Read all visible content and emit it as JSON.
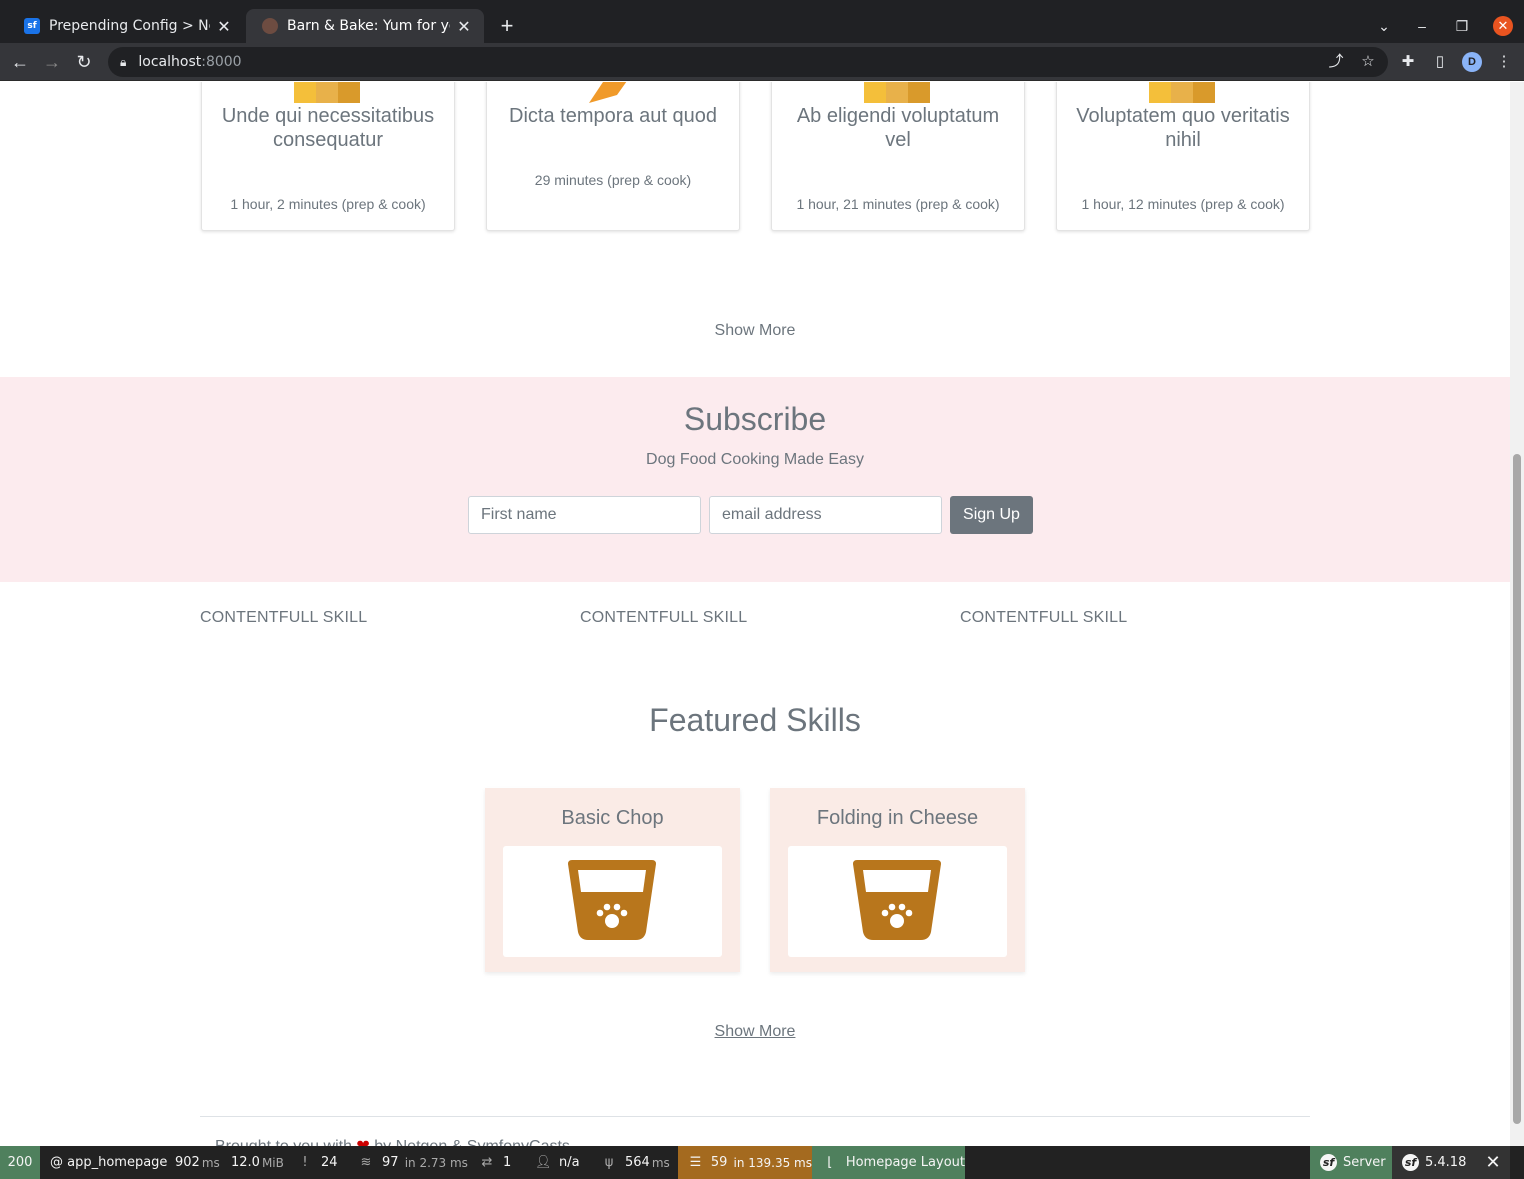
{
  "browser": {
    "tabs": [
      {
        "title": "Prepending Config > Netgen"
      },
      {
        "title": "Barn & Bake: Yum for your dog"
      }
    ],
    "url_host": "localhost",
    "url_port": ":8000",
    "profile_initial": "D"
  },
  "recipes": [
    {
      "title": "Unde qui necessitatibus consequatur",
      "time": "1 hour, 2 minutes (prep & cook)"
    },
    {
      "title": "Dicta tempora aut quod",
      "time": "29 minutes (prep & cook)"
    },
    {
      "title": "Ab eligendi voluptatum vel",
      "time": "1 hour, 21 minutes (prep & cook)"
    },
    {
      "title": "Voluptatem quo veritatis nihil",
      "time": "1 hour, 12 minutes (prep & cook)"
    }
  ],
  "recipes_show_more": "Show More",
  "subscribe": {
    "title": "Subscribe",
    "subtitle": "Dog Food Cooking Made Easy",
    "first_name_placeholder": "First name",
    "email_placeholder": "email address",
    "button": "Sign Up"
  },
  "skill_links": [
    "CONTENTFULL SKILL",
    "CONTENTFULL SKILL",
    "CONTENTFULL SKILL"
  ],
  "featured": {
    "title": "Featured Skills",
    "skills": [
      {
        "title": "Basic Chop"
      },
      {
        "title": "Folding in Cheese"
      }
    ],
    "show_more": "Show More"
  },
  "footer": {
    "prefix": "Brought to you with",
    "suffix": "by Netgen & SymfonyCasts"
  },
  "debug_toolbar": {
    "status": "200",
    "route": "@ app_homepage",
    "time_value": "902",
    "time_unit": "ms",
    "memory_value": "12.0",
    "memory_unit": "MiB",
    "logs": "24",
    "cache_value": "97",
    "cache_in": "in 2.73 ms",
    "translations": "1",
    "user": "n/a",
    "events_value": "564",
    "events_unit": "ms",
    "db_value": "59",
    "db_in": "in 139.35 ms",
    "layout": "Homepage Layout",
    "server": "Server",
    "version": "5.4.18"
  },
  "colors": {
    "subscribe_bg": "#fcebee",
    "featured_card_bg": "#faebe6",
    "bowl": "#b8761c",
    "db_panel": "#a46a1f",
    "success_panel": "#4f805d"
  }
}
